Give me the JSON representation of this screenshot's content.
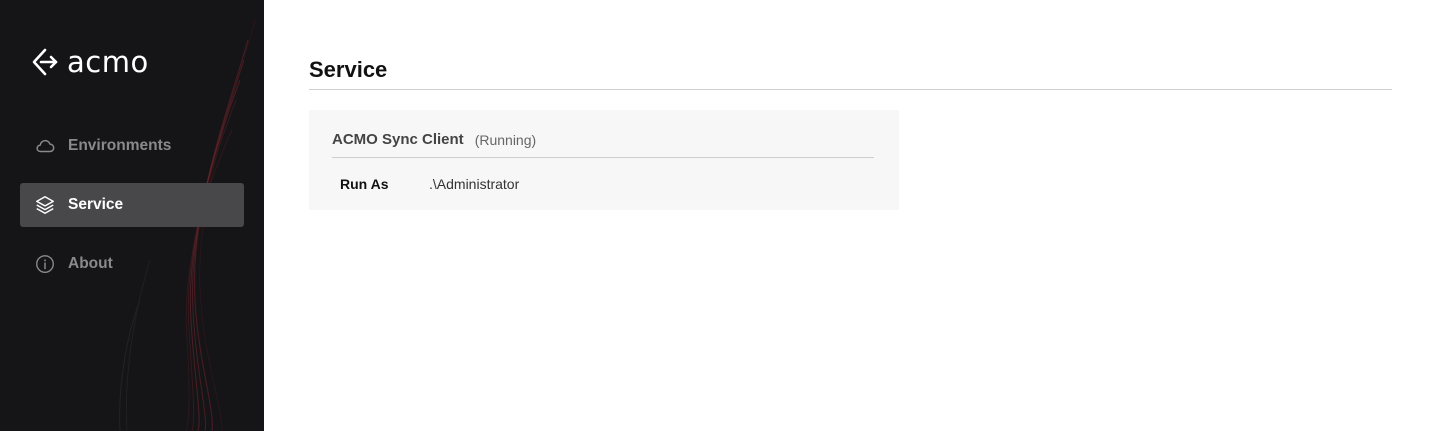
{
  "app": {
    "brand": "acmo"
  },
  "sidebar": {
    "items": [
      {
        "label": "Environments",
        "icon": "cloud-icon",
        "active": false
      },
      {
        "label": "Service",
        "icon": "layers-icon",
        "active": true
      },
      {
        "label": "About",
        "icon": "info-icon",
        "active": false
      }
    ]
  },
  "main": {
    "title": "Service",
    "service": {
      "name": "ACMO Sync Client",
      "status": "(Running)",
      "fields": [
        {
          "key": "Run As",
          "value": ".\\Administrator"
        }
      ]
    }
  },
  "colors": {
    "sidebar_bg": "#151417",
    "active_item_bg": "#48474a",
    "accent_curve": "#7a2a30",
    "card_bg": "#f7f7f7"
  }
}
